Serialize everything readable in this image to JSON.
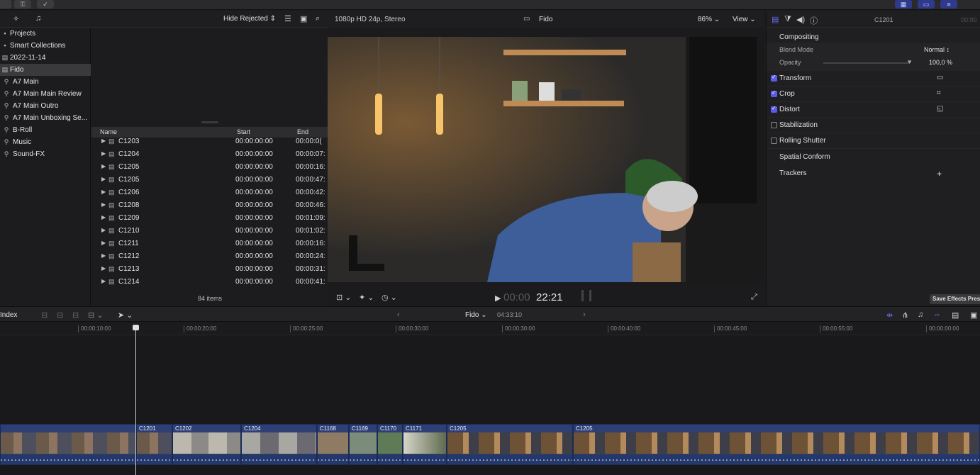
{
  "libraries": {
    "items": [
      {
        "label": "Projects",
        "icon": "folder-icon"
      },
      {
        "label": "Smart Collections",
        "icon": "folder-icon"
      },
      {
        "label": "2022-11-14",
        "icon": "calendar-icon"
      },
      {
        "label": "Fido",
        "icon": "event-icon",
        "selected": true
      },
      {
        "label": "A7 Main",
        "icon": "keyword-icon"
      },
      {
        "label": "A7 Main Main Review",
        "icon": "keyword-icon"
      },
      {
        "label": "A7 Main Outro",
        "icon": "keyword-icon"
      },
      {
        "label": "A7 Main Unboxing Se...",
        "icon": "keyword-icon"
      },
      {
        "label": "B-Roll",
        "icon": "keyword-icon"
      },
      {
        "label": "Music",
        "icon": "keyword-icon"
      },
      {
        "label": "Sound-FX",
        "icon": "keyword-icon"
      }
    ]
  },
  "browser": {
    "filter": "Hide Rejected",
    "columns": {
      "name": "Name",
      "start": "Start",
      "end": "End"
    },
    "rows": [
      {
        "name": "C1203",
        "start": "00:00:00:00",
        "end": "00:00:0("
      },
      {
        "name": "C1204",
        "start": "00:00:00:00",
        "end": "00:00:07:"
      },
      {
        "name": "C1205",
        "start": "00:00:00:00",
        "end": "00:00:16:"
      },
      {
        "name": "C1205",
        "start": "00:00:00:00",
        "end": "00:00:47:"
      },
      {
        "name": "C1206",
        "start": "00:00:00:00",
        "end": "00:00:42:"
      },
      {
        "name": "C1208",
        "start": "00:00:00:00",
        "end": "00:00:46:"
      },
      {
        "name": "C1209",
        "start": "00:00:00:00",
        "end": "00:01:09:"
      },
      {
        "name": "C1210",
        "start": "00:00:00:00",
        "end": "00:01:02:"
      },
      {
        "name": "C1211",
        "start": "00:00:00:00",
        "end": "00:00:16:"
      },
      {
        "name": "C1212",
        "start": "00:00:00:00",
        "end": "00:00:24:"
      },
      {
        "name": "C1213",
        "start": "00:00:00:00",
        "end": "00:00:31:"
      },
      {
        "name": "C1214",
        "start": "00:00:00:00",
        "end": "00:00:41:"
      }
    ],
    "items_count": "84 items"
  },
  "viewer": {
    "format": "1080p HD 24p, Stereo",
    "clip_title": "Fido",
    "zoom": "86%",
    "view_label": "View",
    "timecode_dim": "00:00",
    "timecode": "22:21"
  },
  "inspector": {
    "clip_name": "C1201",
    "clip_name_right": "00:00",
    "sections": [
      {
        "label": "Compositing",
        "checkbox": null
      },
      {
        "label": "Blend Mode",
        "value": "Normal ↕"
      },
      {
        "label": "Opacity",
        "value": "100,0 %"
      },
      {
        "label": "Transform",
        "checkbox": true
      },
      {
        "label": "Crop",
        "checkbox": true
      },
      {
        "label": "Distort",
        "checkbox": true
      },
      {
        "label": "Stabilization",
        "checkbox": false
      },
      {
        "label": "Rolling Shutter",
        "checkbox": false
      },
      {
        "label": "Spatial Conform",
        "checkbox": null
      },
      {
        "label": "Trackers",
        "checkbox": null,
        "action": "+"
      }
    ],
    "save_preset": "Save Effects Pres"
  },
  "timeline": {
    "index_label": "Index",
    "project": "Fido",
    "duration": "04:33:10",
    "ruler_ticks": [
      "00:00:10:00",
      "00:00:20:00",
      "00:00:25:00",
      "00:00:30:00",
      "00:00:40:00",
      "00:00:45:00",
      "00:00:50:00",
      "00:00:55:00",
      "00:00:00:00"
    ],
    "clips": [
      {
        "name": ""
      },
      {
        "name": "C1201"
      },
      {
        "name": "C1202"
      },
      {
        "name": "C1204"
      },
      {
        "name": "C1168"
      },
      {
        "name": "C1169"
      },
      {
        "name": "C1170"
      },
      {
        "name": "C1171"
      },
      {
        "name": "C1205"
      },
      {
        "name": "C1205"
      }
    ]
  },
  "colors": {
    "accent": "#5a5ce8",
    "clip": "#2e3f75",
    "background": "#1b1b1d"
  }
}
